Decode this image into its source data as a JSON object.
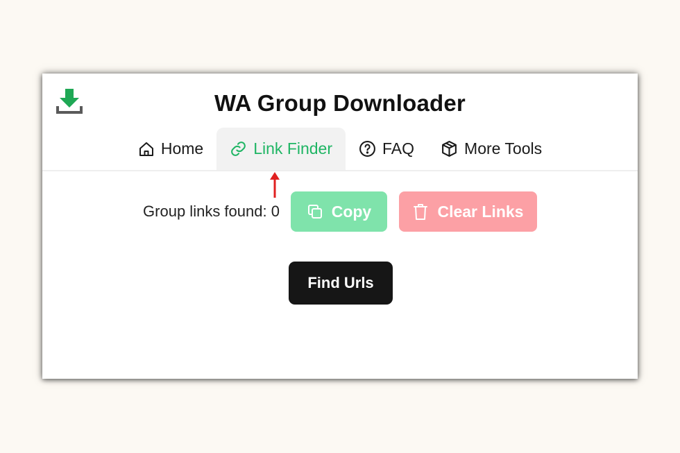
{
  "app": {
    "title": "WA Group Downloader",
    "logo_icon": "download-icon",
    "logo_color": "#1fa855"
  },
  "nav": {
    "tabs": [
      {
        "label": "Home",
        "icon": "home-icon",
        "active": false
      },
      {
        "label": "Link Finder",
        "icon": "link-icon",
        "active": true
      },
      {
        "label": "FAQ",
        "icon": "question-circle-icon",
        "active": false
      },
      {
        "label": "More Tools",
        "icon": "box-icon",
        "active": false
      }
    ],
    "active_color": "#1fb564"
  },
  "annotation": {
    "icon": "arrow-up-icon",
    "color": "#e02020"
  },
  "finder": {
    "found_label": "Group links found: 0",
    "copy_label": "Copy",
    "copy_icon": "copy-icon",
    "copy_color": "#7fe3ab",
    "clear_label": "Clear Links",
    "clear_icon": "trash-icon",
    "clear_color": "#fca0a5",
    "find_label": "Find Urls",
    "find_color": "#161616"
  }
}
